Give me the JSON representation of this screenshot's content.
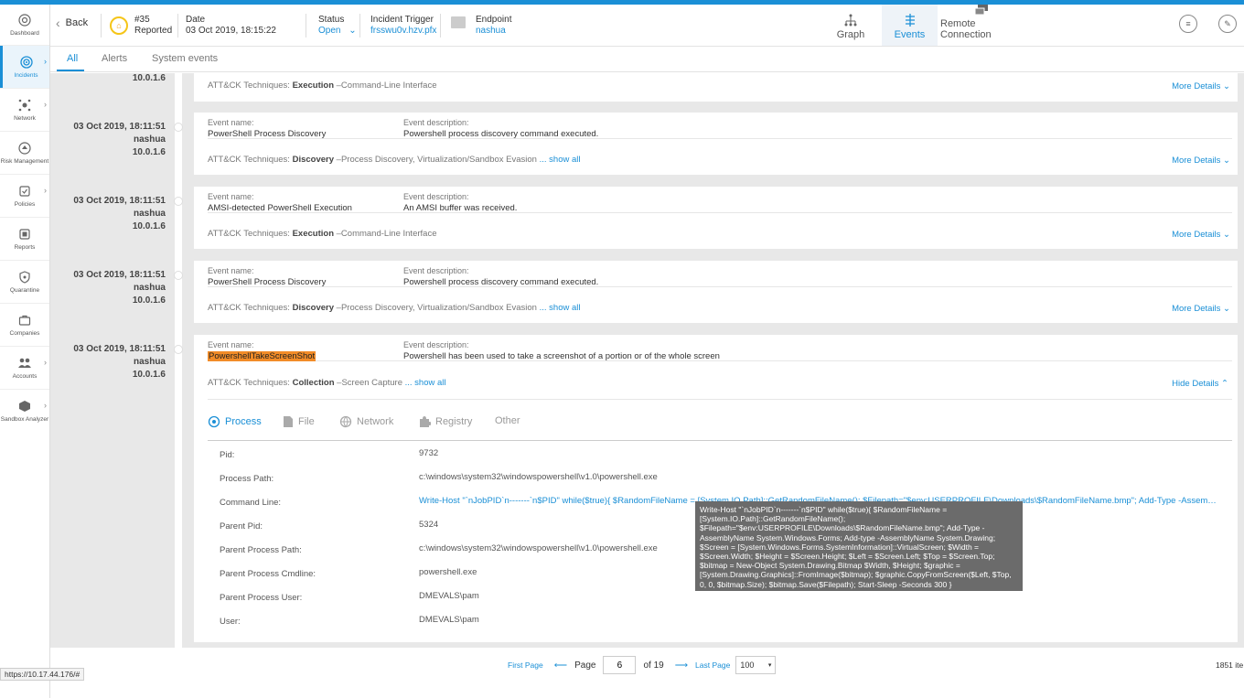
{
  "nav": [
    {
      "label": "Dashboard",
      "icon": "dashboard-icon"
    },
    {
      "label": "Incidents",
      "icon": "incidents-icon",
      "active": true
    },
    {
      "label": "Network",
      "icon": "network-icon"
    },
    {
      "label": "Risk Management",
      "icon": "risk-icon"
    },
    {
      "label": "Policies",
      "icon": "policies-icon"
    },
    {
      "label": "Reports",
      "icon": "reports-icon"
    },
    {
      "label": "Quarantine",
      "icon": "quarantine-icon"
    },
    {
      "label": "Companies",
      "icon": "companies-icon"
    },
    {
      "label": "Accounts",
      "icon": "accounts-icon"
    },
    {
      "label": "Sandbox Analyzer",
      "icon": "sandbox-icon"
    }
  ],
  "header": {
    "back": "Back",
    "incident_id": "#35",
    "incident_state": "Reported",
    "date_label": "Date",
    "date_value": "03 Oct 2019, 18:15:22",
    "status_label": "Status",
    "status_value": "Open",
    "trigger_label": "Incident Trigger",
    "trigger_value": "frsswu0v.hzv.pfx",
    "endpoint_label": "Endpoint",
    "endpoint_value": "nashua",
    "tabs": {
      "graph": "Graph",
      "events": "Events",
      "remote": "Remote Connection"
    }
  },
  "subtabs": {
    "all": "All",
    "alerts": "Alerts",
    "system": "System events"
  },
  "events": [
    {
      "partial": true,
      "ip": "10.0.1.6",
      "attck_prefix": "ATT&CK Techniques:",
      "attck_tactic": "Execution",
      "attck_rest": " –Command-Line Interface",
      "more": "More Details"
    },
    {
      "date": "03 Oct 2019, 18:11:51",
      "host": "nashua",
      "ip": "10.0.1.6",
      "name_label": "Event name:",
      "name": "PowerShell Process Discovery",
      "desc_label": "Event description:",
      "desc": "Powershell process discovery command executed.",
      "attck_prefix": "ATT&CK Techniques:",
      "attck_tactic": "Discovery",
      "attck_rest": " –Process Discovery, Virtualization/Sandbox Evasion",
      "show_all": "... show all",
      "more": "More Details"
    },
    {
      "date": "03 Oct 2019, 18:11:51",
      "host": "nashua",
      "ip": "10.0.1.6",
      "name_label": "Event name:",
      "name": "AMSI-detected PowerShell Execution",
      "desc_label": "Event description:",
      "desc": "An AMSI buffer was received.",
      "attck_prefix": "ATT&CK Techniques:",
      "attck_tactic": "Execution",
      "attck_rest": " –Command-Line Interface",
      "more": "More Details"
    },
    {
      "date": "03 Oct 2019, 18:11:51",
      "host": "nashua",
      "ip": "10.0.1.6",
      "name_label": "Event name:",
      "name": "PowerShell Process Discovery",
      "desc_label": "Event description:",
      "desc": "Powershell process discovery command executed.",
      "attck_prefix": "ATT&CK Techniques:",
      "attck_tactic": "Discovery",
      "attck_rest": " –Process Discovery, Virtualization/Sandbox Evasion",
      "show_all": "... show all",
      "more": "More Details"
    },
    {
      "date": "03 Oct 2019, 18:11:51",
      "host": "nashua",
      "ip": "10.0.1.6",
      "name_label": "Event name:",
      "name": "PowershellTakeScreenShot",
      "desc_label": "Event description:",
      "desc": "Powershell has been used to take a screenshot of a portion or of the whole screen",
      "attck_prefix": "ATT&CK Techniques:",
      "attck_tactic": "Collection",
      "attck_rest": " –Screen Capture",
      "show_all": "... show all",
      "hide": "Hide Details"
    }
  ],
  "detail_tabs": [
    "Process",
    "File",
    "Network",
    "Registry",
    "Other"
  ],
  "details": [
    {
      "key": "Pid:",
      "value": "9732"
    },
    {
      "key": "Process Path:",
      "value": "c:\\windows\\system32\\windowspowershell\\v1.0\\powershell.exe"
    },
    {
      "key": "Command Line:",
      "value": "Write-Host \"`nJobPID`n-------`n$PID\" while($true){ $RandomFileName = [System.IO.Path]::GetRandomFileName(); $Filepath=\"$env:USERPROFILE\\Downloads\\$RandomFileName.bmp\"; Add-Type -AssemblyNa ..."
    },
    {
      "key": "Parent Pid:",
      "value": "5324"
    },
    {
      "key": "Parent Process Path:",
      "value": "c:\\windows\\system32\\windowspowershell\\v1.0\\powershell.exe"
    },
    {
      "key": "Parent Process Cmdline:",
      "value": "powershell.exe"
    },
    {
      "key": "Parent Process User:",
      "value": "DMEVALS\\pam"
    },
    {
      "key": "User:",
      "value": "DMEVALS\\pam"
    }
  ],
  "tooltip": "Write-Host \"`nJobPID`n-------`n$PID\" while($true){ $RandomFileName = [System.IO.Path]::GetRandomFileName(); $Filepath=\"$env:USERPROFILE\\Downloads\\$RandomFileName.bmp\"; Add-Type -AssemblyName System.Windows.Forms; Add-type -AssemblyName System.Drawing; $Screen = [System.Windows.Forms.SystemInformation]::VirtualScreen; $Width = $Screen.Width; $Height = $Screen.Height; $Left = $Screen.Left; $Top = $Screen.Top; $bitmap = New-Object System.Drawing.Bitmap $Width, $Height; $graphic = [System.Drawing.Graphics]::FromImage($bitmap); $graphic.CopyFromScreen($Left, $Top, 0, 0, $bitmap.Size); $bitmap.Save($Filepath); Start-Sleep -Seconds 300 }",
  "pager": {
    "first": "First Page",
    "page_label": "Page",
    "page": "6",
    "of": "of 19",
    "last": "Last Page",
    "per_page": "100",
    "total": "1851 ite"
  },
  "status_url": "https://10.17.44.176/#"
}
